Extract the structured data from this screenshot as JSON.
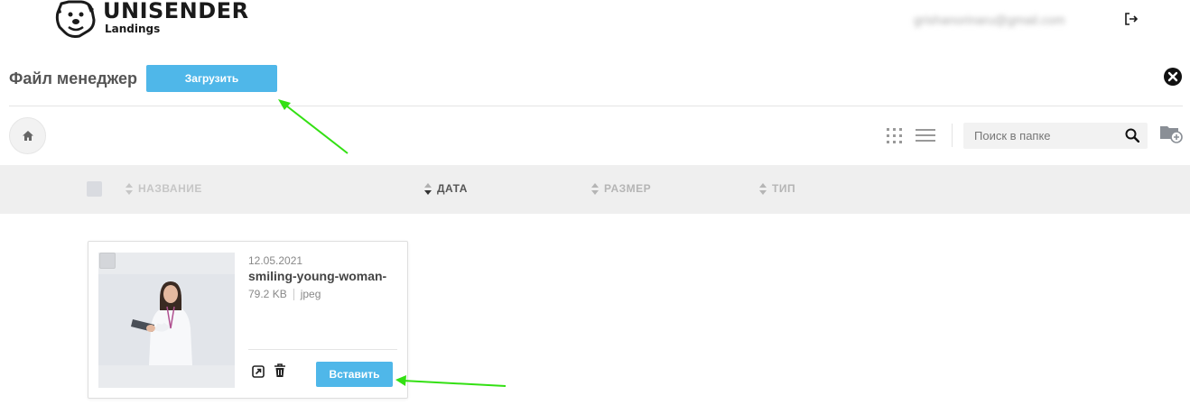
{
  "header": {
    "brand": "UNISENDER",
    "product": "Landings",
    "user_email": "grishanorinaru@gmail.com",
    "logout_icon": "logout-icon"
  },
  "file_manager": {
    "title": "Файл менеджер",
    "upload_label": "Загрузить",
    "close_icon": "close-icon"
  },
  "toolbar": {
    "home_icon": "home-icon",
    "grid_view_icon": "grid-view-icon",
    "list_view_icon": "list-view-icon",
    "search_placeholder": "Поиск в папке",
    "search_value": "",
    "new_folder_icon": "new-folder-icon"
  },
  "columns": [
    {
      "label": "НАЗВАНИЕ",
      "active": false
    },
    {
      "label": "ДАТА",
      "active": true
    },
    {
      "label": "РАЗМЕР",
      "active": false
    },
    {
      "label": "ТИП",
      "active": false
    }
  ],
  "files": [
    {
      "date": "12.05.2021",
      "name": "smiling-young-woman-",
      "size": "79.2 KB",
      "type": "jpeg",
      "insert_label": "Вставить"
    }
  ],
  "colors": {
    "accent": "#4fb7e9",
    "annotation_arrow": "#33e013",
    "column_bar": "#efefef"
  }
}
